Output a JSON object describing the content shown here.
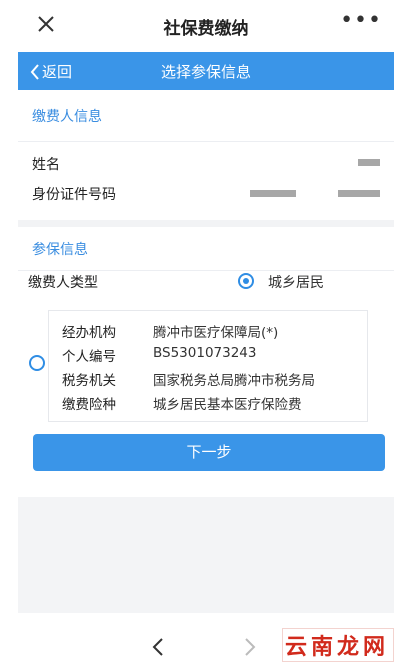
{
  "top_bar": {
    "title": "社保费缴纳",
    "more": "•••"
  },
  "nav": {
    "back_label": "返回",
    "title": "选择参保信息"
  },
  "payer_section": {
    "heading": "缴费人信息",
    "name_label": "姓名",
    "id_label": "身份证件号码"
  },
  "insured_section": {
    "heading": "参保信息",
    "payer_type_label": "缴费人类型",
    "payer_type_value": "城乡居民"
  },
  "record": {
    "agency_label": "经办机构",
    "agency_value": "腾冲市医疗保障局(*)",
    "number_label": "个人编号",
    "number_value": "BS5301073243",
    "tax_label": "税务机关",
    "tax_value": "国家税务总局腾冲市税务局",
    "type_label": "缴费险种",
    "type_value": "城乡居民基本医疗保险费"
  },
  "next_button": "下一步",
  "watermark": {
    "brand_text": "云南龙网"
  },
  "colors": {
    "accent": "#3a95e8",
    "section_text": "#3a8de0"
  }
}
